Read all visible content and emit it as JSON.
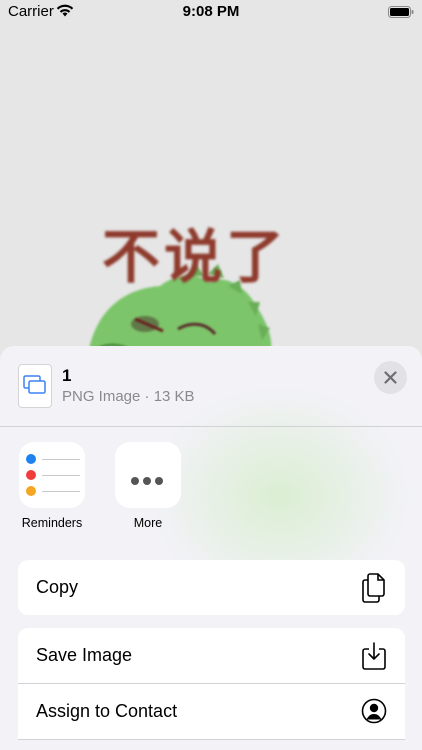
{
  "status": {
    "carrier": "Carrier",
    "time": "9:08 PM"
  },
  "image": {
    "text": "不说了"
  },
  "share": {
    "file": {
      "name": "1",
      "meta": "PNG Image · 13 KB"
    },
    "apps": [
      {
        "label": "Reminders"
      },
      {
        "label": "More"
      }
    ],
    "actions": [
      {
        "label": "Copy",
        "icon": "copy-icon"
      },
      {
        "label": "Save Image",
        "icon": "save-icon"
      },
      {
        "label": "Assign to Contact",
        "icon": "contact-icon"
      }
    ],
    "colors": {
      "reminder_blue": "#1e82f0",
      "reminder_red": "#f03c3c",
      "reminder_orange": "#f5a623"
    }
  }
}
